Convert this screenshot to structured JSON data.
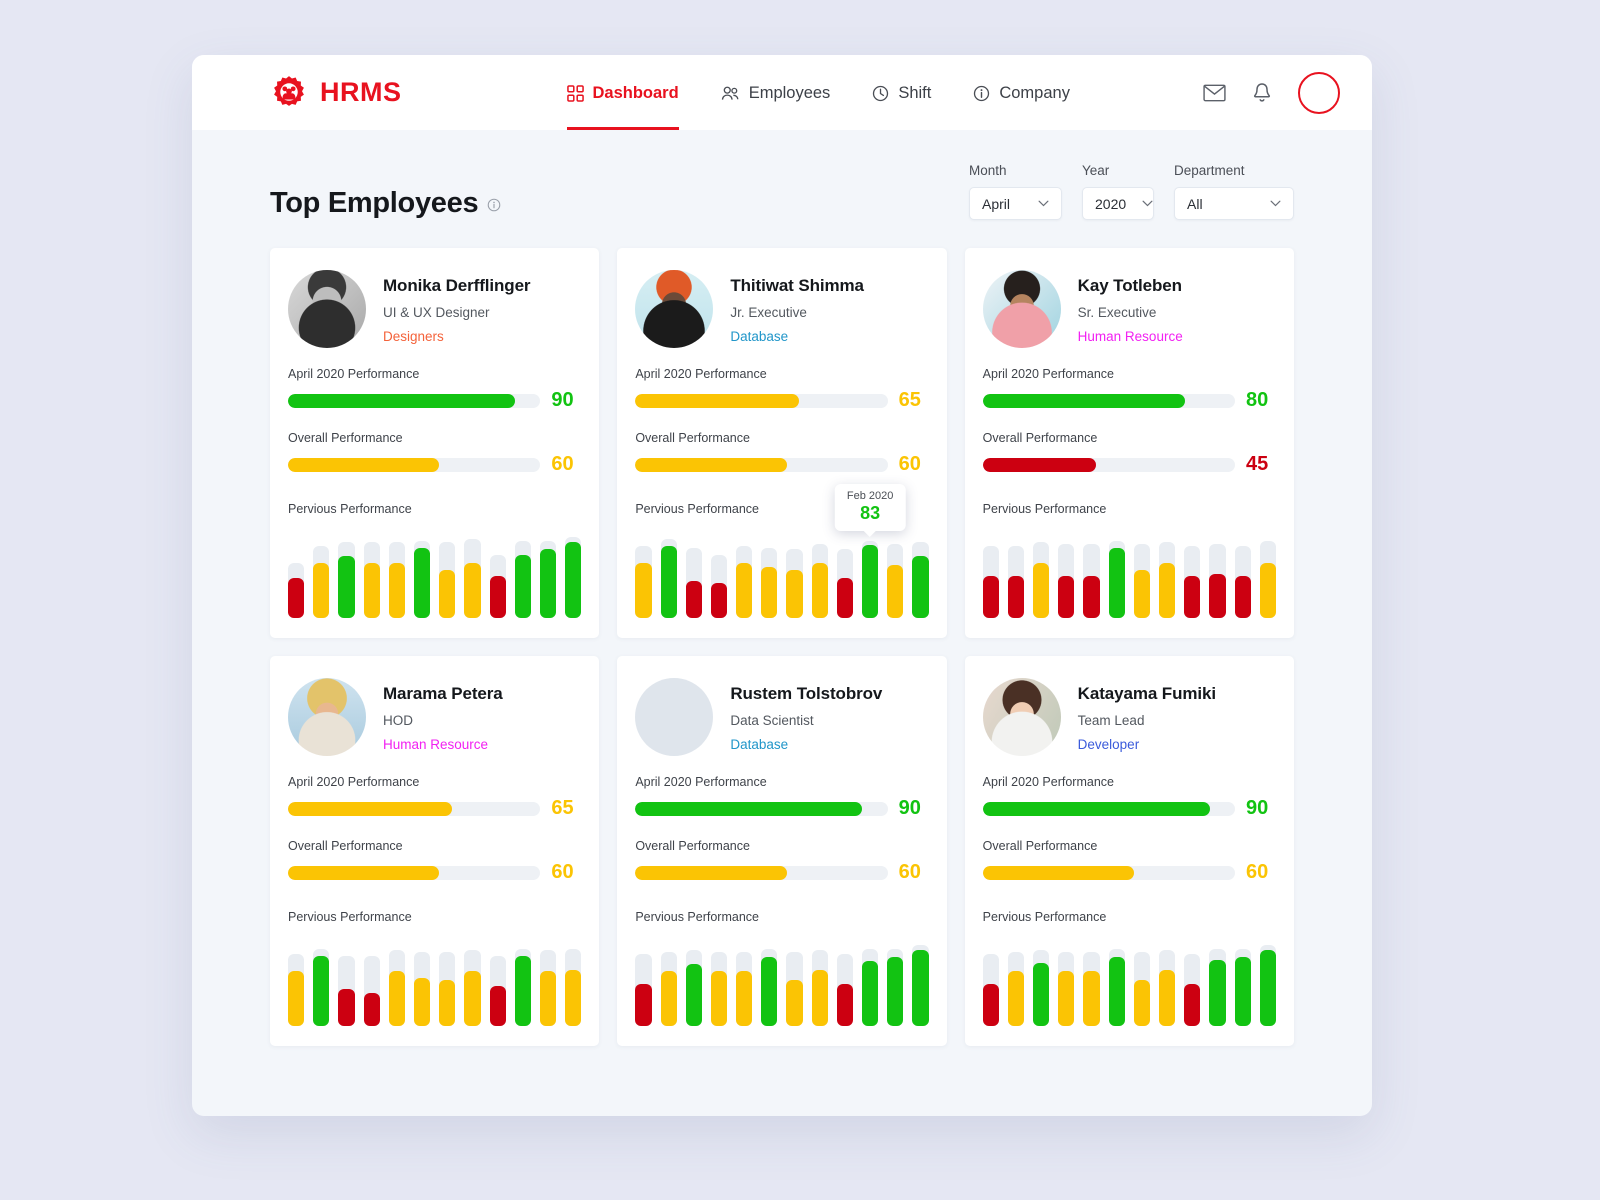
{
  "brand": {
    "name": "HRMS",
    "icon": "gear-people-logo",
    "color": "#e8121f"
  },
  "nav": {
    "items": [
      {
        "label": "Dashboard",
        "icon": "grid-icon",
        "active": true
      },
      {
        "label": "Employees",
        "icon": "people-icon",
        "active": false
      },
      {
        "label": "Shift",
        "icon": "clock-icon",
        "active": false
      },
      {
        "label": "Company",
        "icon": "info-circle-icon",
        "active": false
      }
    ]
  },
  "header_actions": {
    "mail_icon": "envelope-icon",
    "bell_icon": "bell-icon",
    "avatar": "user-avatar"
  },
  "page": {
    "title": "Top Employees",
    "info_icon": "info-circle-icon"
  },
  "filters": [
    {
      "label": "Month",
      "value": "April",
      "name": "month",
      "width": "w-month"
    },
    {
      "label": "Year",
      "value": "2020",
      "name": "year",
      "width": "w-year"
    },
    {
      "label": "Department",
      "value": "All",
      "name": "department",
      "width": "w-dept"
    }
  ],
  "labels": {
    "monthly_performance": "April 2020 Performance",
    "overall_performance": "Overall Performance",
    "previous_performance": "Pervious Performance"
  },
  "colors": {
    "green": "#12c312",
    "yellow": "#fbc404",
    "red": "#cc0011",
    "track": "#eef1f5",
    "bar_track": "#e9edf2",
    "designers": "#f4623a",
    "database": "#2196c9",
    "human_resource": "#f221f2",
    "developer": "#3b5bdb"
  },
  "tooltip": {
    "date": "Feb 2020",
    "value": "83",
    "card_index": 1,
    "bar_index": 9
  },
  "chart_data": {
    "type": "bar",
    "title": "Pervious Performance (per employee, 12 months)",
    "ylim": [
      0,
      100
    ],
    "series": [
      {
        "name": "Monika Derfflinger",
        "values": [
          45,
          62,
          70,
          62,
          62,
          80,
          55,
          63,
          48,
          72,
          78,
          86
        ]
      },
      {
        "name": "Thitiwat Shimma",
        "values": [
          63,
          82,
          42,
          40,
          63,
          58,
          55,
          63,
          45,
          83,
          60,
          70
        ]
      },
      {
        "name": "Kay Totleben",
        "values": [
          48,
          48,
          62,
          48,
          48,
          80,
          55,
          62,
          48,
          50,
          48,
          62
        ]
      },
      {
        "name": "Marama Petera",
        "values": [
          62,
          80,
          42,
          38,
          63,
          55,
          52,
          63,
          45,
          80,
          62,
          64
        ]
      },
      {
        "name": "Rustem Tolstobrov",
        "values": [
          48,
          63,
          70,
          62,
          62,
          78,
          52,
          64,
          48,
          74,
          78,
          86
        ]
      },
      {
        "name": "Katayama Fumiki",
        "values": [
          48,
          63,
          72,
          62,
          62,
          78,
          52,
          64,
          48,
          75,
          78,
          86
        ]
      }
    ]
  },
  "employees": [
    {
      "name": "Monika Derfflinger",
      "role": "UI & UX Designer",
      "department": "Designers",
      "dept_color": "#f4623a",
      "photo": "photo-monika",
      "monthly": {
        "value": 90,
        "color": "#12c312"
      },
      "overall": {
        "value": 60,
        "color": "#fbc404"
      },
      "bars": [
        {
          "v": 45,
          "c": "#cc0011",
          "t": 62
        },
        {
          "v": 62,
          "c": "#fbc404",
          "t": 82
        },
        {
          "v": 70,
          "c": "#12c312",
          "t": 86
        },
        {
          "v": 62,
          "c": "#fbc404",
          "t": 86
        },
        {
          "v": 62,
          "c": "#fbc404",
          "t": 86
        },
        {
          "v": 80,
          "c": "#12c312",
          "t": 88
        },
        {
          "v": 55,
          "c": "#fbc404",
          "t": 86
        },
        {
          "v": 63,
          "c": "#fbc404",
          "t": 90
        },
        {
          "v": 48,
          "c": "#cc0011",
          "t": 72
        },
        {
          "v": 72,
          "c": "#12c312",
          "t": 88
        },
        {
          "v": 78,
          "c": "#12c312",
          "t": 88
        },
        {
          "v": 86,
          "c": "#12c312",
          "t": 92
        }
      ]
    },
    {
      "name": "Thitiwat Shimma",
      "role": "Jr. Executive",
      "department": "Database",
      "dept_color": "#2196c9",
      "photo": "photo-thitiwat",
      "monthly": {
        "value": 65,
        "color": "#fbc404"
      },
      "overall": {
        "value": 60,
        "color": "#fbc404"
      },
      "bars": [
        {
          "v": 63,
          "c": "#fbc404",
          "t": 82
        },
        {
          "v": 82,
          "c": "#12c312",
          "t": 90
        },
        {
          "v": 42,
          "c": "#cc0011",
          "t": 80
        },
        {
          "v": 40,
          "c": "#cc0011",
          "t": 72
        },
        {
          "v": 63,
          "c": "#fbc404",
          "t": 82
        },
        {
          "v": 58,
          "c": "#fbc404",
          "t": 80
        },
        {
          "v": 55,
          "c": "#fbc404",
          "t": 78
        },
        {
          "v": 63,
          "c": "#fbc404",
          "t": 84
        },
        {
          "v": 45,
          "c": "#cc0011",
          "t": 78
        },
        {
          "v": 83,
          "c": "#12c312",
          "t": 88
        },
        {
          "v": 60,
          "c": "#fbc404",
          "t": 84
        },
        {
          "v": 70,
          "c": "#12c312",
          "t": 86
        }
      ]
    },
    {
      "name": "Kay Totleben",
      "role": "Sr. Executive",
      "department": "Human Resource",
      "dept_color": "#f221f2",
      "photo": "photo-kay",
      "monthly": {
        "value": 80,
        "color": "#12c312"
      },
      "overall": {
        "value": 45,
        "color": "#cc0011"
      },
      "bars": [
        {
          "v": 48,
          "c": "#cc0011",
          "t": 82
        },
        {
          "v": 48,
          "c": "#cc0011",
          "t": 82
        },
        {
          "v": 62,
          "c": "#fbc404",
          "t": 86
        },
        {
          "v": 48,
          "c": "#cc0011",
          "t": 84
        },
        {
          "v": 48,
          "c": "#cc0011",
          "t": 84
        },
        {
          "v": 80,
          "c": "#12c312",
          "t": 88
        },
        {
          "v": 55,
          "c": "#fbc404",
          "t": 84
        },
        {
          "v": 62,
          "c": "#fbc404",
          "t": 86
        },
        {
          "v": 48,
          "c": "#cc0011",
          "t": 82
        },
        {
          "v": 50,
          "c": "#cc0011",
          "t": 84
        },
        {
          "v": 48,
          "c": "#cc0011",
          "t": 82
        },
        {
          "v": 62,
          "c": "#fbc404",
          "t": 88
        }
      ]
    },
    {
      "name": "Marama Petera",
      "role": "HOD",
      "department": "Human Resource",
      "dept_color": "#f221f2",
      "photo": "photo-marama",
      "monthly": {
        "value": 65,
        "color": "#fbc404"
      },
      "overall": {
        "value": 60,
        "color": "#fbc404"
      },
      "bars": [
        {
          "v": 62,
          "c": "#fbc404",
          "t": 82
        },
        {
          "v": 80,
          "c": "#12c312",
          "t": 88
        },
        {
          "v": 42,
          "c": "#cc0011",
          "t": 80
        },
        {
          "v": 38,
          "c": "#cc0011",
          "t": 80
        },
        {
          "v": 63,
          "c": "#fbc404",
          "t": 86
        },
        {
          "v": 55,
          "c": "#fbc404",
          "t": 84
        },
        {
          "v": 52,
          "c": "#fbc404",
          "t": 84
        },
        {
          "v": 63,
          "c": "#fbc404",
          "t": 86
        },
        {
          "v": 45,
          "c": "#cc0011",
          "t": 80
        },
        {
          "v": 80,
          "c": "#12c312",
          "t": 88
        },
        {
          "v": 62,
          "c": "#fbc404",
          "t": 86
        },
        {
          "v": 64,
          "c": "#fbc404",
          "t": 88
        }
      ]
    },
    {
      "name": "Rustem Tolstobrov",
      "role": "Data Scientist",
      "department": "Database",
      "dept_color": "#2196c9",
      "photo": "photo-rustem",
      "monthly": {
        "value": 90,
        "color": "#12c312"
      },
      "overall": {
        "value": 60,
        "color": "#fbc404"
      },
      "bars": [
        {
          "v": 48,
          "c": "#cc0011",
          "t": 82
        },
        {
          "v": 63,
          "c": "#fbc404",
          "t": 84
        },
        {
          "v": 70,
          "c": "#12c312",
          "t": 86
        },
        {
          "v": 62,
          "c": "#fbc404",
          "t": 84
        },
        {
          "v": 62,
          "c": "#fbc404",
          "t": 84
        },
        {
          "v": 78,
          "c": "#12c312",
          "t": 88
        },
        {
          "v": 52,
          "c": "#fbc404",
          "t": 84
        },
        {
          "v": 64,
          "c": "#fbc404",
          "t": 86
        },
        {
          "v": 48,
          "c": "#cc0011",
          "t": 82
        },
        {
          "v": 74,
          "c": "#12c312",
          "t": 88
        },
        {
          "v": 78,
          "c": "#12c312",
          "t": 88
        },
        {
          "v": 86,
          "c": "#12c312",
          "t": 92
        }
      ]
    },
    {
      "name": "Katayama Fumiki",
      "role": "Team Lead",
      "department": "Developer",
      "dept_color": "#3b5bdb",
      "photo": "photo-katayama",
      "monthly": {
        "value": 90,
        "color": "#12c312"
      },
      "overall": {
        "value": 60,
        "color": "#fbc404"
      },
      "bars": [
        {
          "v": 48,
          "c": "#cc0011",
          "t": 82
        },
        {
          "v": 63,
          "c": "#fbc404",
          "t": 84
        },
        {
          "v": 72,
          "c": "#12c312",
          "t": 86
        },
        {
          "v": 62,
          "c": "#fbc404",
          "t": 84
        },
        {
          "v": 62,
          "c": "#fbc404",
          "t": 84
        },
        {
          "v": 78,
          "c": "#12c312",
          "t": 88
        },
        {
          "v": 52,
          "c": "#fbc404",
          "t": 84
        },
        {
          "v": 64,
          "c": "#fbc404",
          "t": 86
        },
        {
          "v": 48,
          "c": "#cc0011",
          "t": 82
        },
        {
          "v": 75,
          "c": "#12c312",
          "t": 88
        },
        {
          "v": 78,
          "c": "#12c312",
          "t": 88
        },
        {
          "v": 86,
          "c": "#12c312",
          "t": 92
        }
      ]
    }
  ]
}
